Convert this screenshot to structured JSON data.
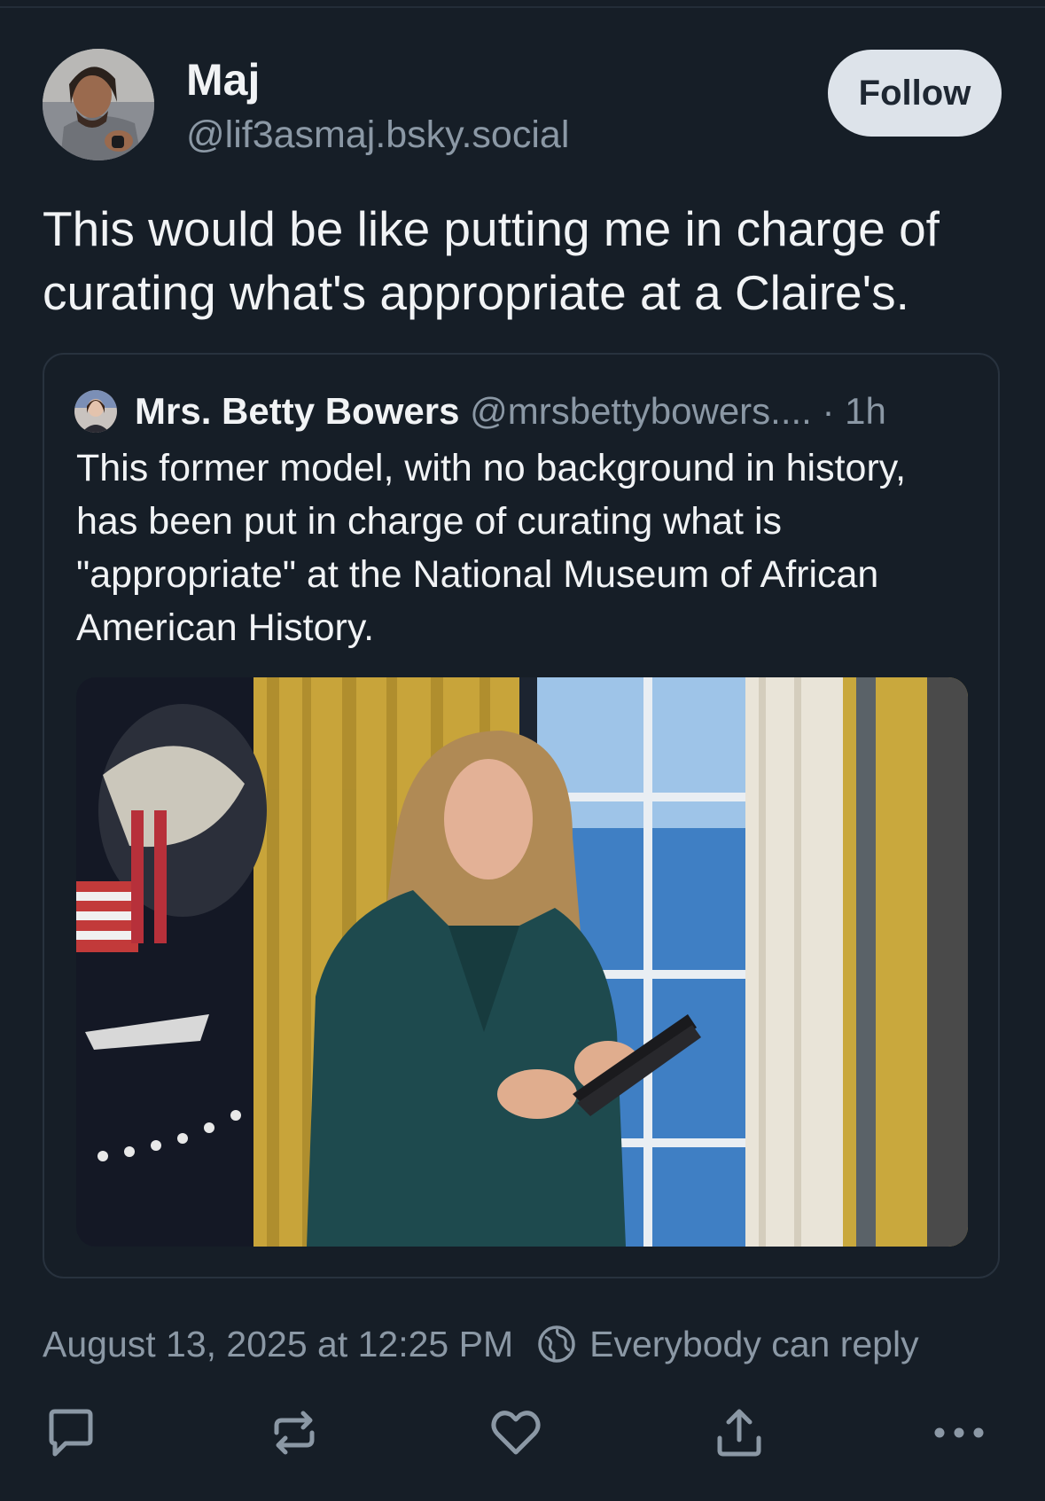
{
  "author": {
    "name": "Maj",
    "handle": "@lif3asmaj.bsky.social",
    "follow_label": "Follow"
  },
  "post": {
    "text": "This would be like putting me in charge of curating what's appropriate at a Claire's.",
    "timestamp": "August 13, 2025 at 12:25 PM",
    "reply_setting": "Everybody can reply"
  },
  "quote": {
    "name": "Mrs. Betty Bowers",
    "handle": "@mrsbettybowers....",
    "time": "· 1h",
    "text": "This former model, with no background in history, has been put in charge of curating what is \"appropriate\" at the National Museum of African American History."
  },
  "icons": {
    "reply": "comment-icon",
    "repost": "repost-icon",
    "like": "heart-icon",
    "share": "share-icon",
    "more": "more-icon",
    "reply_setting": "globe-icon"
  },
  "colors": {
    "background": "#161e27",
    "text_primary": "#f1f3f5",
    "text_secondary": "#8b98a5",
    "follow_button_bg": "#dde3ea",
    "card_border": "#28323e"
  }
}
